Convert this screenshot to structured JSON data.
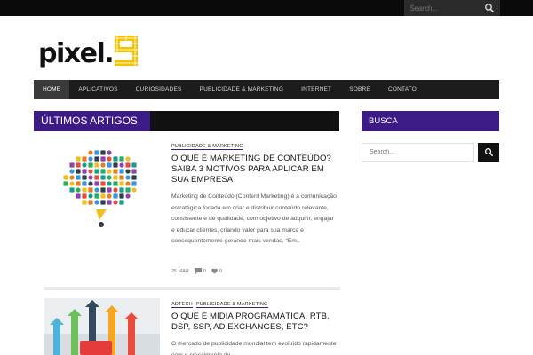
{
  "topbar": {
    "search_placeholder": "Search..."
  },
  "logo": {
    "text": "pixel.",
    "accent_color": "#f2c300"
  },
  "nav": [
    {
      "label": "HOME",
      "active": true
    },
    {
      "label": "APLICATIVOS"
    },
    {
      "label": "CURIOSIDADES"
    },
    {
      "label": "PUBLICIDADE & MARKETING"
    },
    {
      "label": "INTERNET"
    },
    {
      "label": "SOBRE"
    },
    {
      "label": "CONTATO"
    }
  ],
  "main": {
    "section_title": "ÚLTIMOS ARTIGOS"
  },
  "sidebar": {
    "section_title": "BUSCA",
    "search_placeholder": "Search..."
  },
  "articles": [
    {
      "categories": [
        "PUBLICIDADE & MARKETING"
      ],
      "title": "O QUE É MARKETING DE CONTEÚDO? SAIBA 3 MOTIVOS PARA APLICAR EM SUA EMPRESA",
      "excerpt": "Marketing de Conteúdo (Content Marketing) é a comunicação estratégica focada em criar e distribuir conteúdo relevante, consistente e de qualidade, com objetivo de adquirir, engajar e educar clientes, criando valor para sua marca e consequentemente gerando mais vendas. “Em..",
      "date": "25 MAR",
      "comments": "0",
      "likes": "0"
    },
    {
      "categories": [
        "ADTECH",
        "PUBLICIDADE & MARKETING"
      ],
      "title": "O QUE É MÍDIA PROGRAMÁTICA, RTB, DSP, SSP, AD EXCHANGES, ETC?",
      "excerpt": "O mercado de publicidade mundial tem evoluído rapidamente com o crescimento de"
    }
  ],
  "colors": {
    "accent": "#3c1b86",
    "nav_bg": "#1c1c1c",
    "topbar_bg": "#0a0a0a"
  }
}
